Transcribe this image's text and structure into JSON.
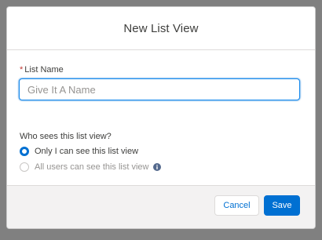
{
  "dialog": {
    "title": "New List View"
  },
  "form": {
    "list_name": {
      "required_mark": "*",
      "label": "List Name",
      "value": "",
      "placeholder": "Give It A Name"
    },
    "visibility": {
      "legend": "Who sees this list view?",
      "options": [
        {
          "label": "Only I can see this list view",
          "checked": true
        },
        {
          "label": "All users can see this list view",
          "checked": false
        }
      ],
      "info_icon": "info-circle-icon"
    }
  },
  "footer": {
    "cancel_label": "Cancel",
    "save_label": "Save"
  },
  "colors": {
    "accent": "#0070d2",
    "required": "#c23934",
    "backdrop": "#808080"
  }
}
